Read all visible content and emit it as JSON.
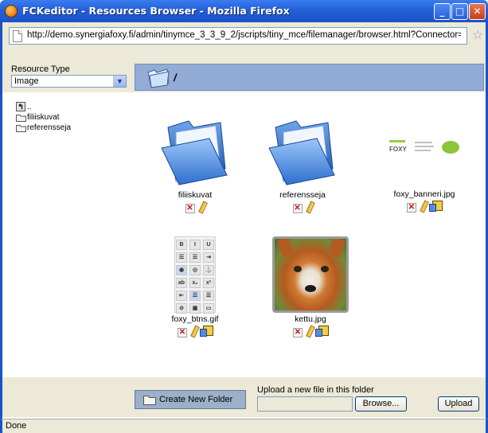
{
  "window": {
    "title": "FCKeditor - Resources Browser - Mozilla Firefox",
    "min_icon": "minimize-icon",
    "max_icon": "maximize-icon",
    "close_icon": "close-icon"
  },
  "urlbar": {
    "url": "http://demo.synergiafoxy.fi/admin/tinymce_3_3_9_2/jscripts/tiny_mce/filemanager/browser.html?Connector="
  },
  "resource_type": {
    "label": "Resource Type",
    "selected": "Image"
  },
  "path": {
    "current": "/"
  },
  "tree": {
    "items": [
      {
        "label": "..",
        "icon": "folder-up-icon"
      },
      {
        "label": "filiiskuvat",
        "icon": "folder-icon"
      },
      {
        "label": "referensseja",
        "icon": "folder-icon"
      }
    ]
  },
  "files": [
    {
      "name": "filiiskuvat",
      "kind": "folder"
    },
    {
      "name": "referensseja",
      "kind": "folder"
    },
    {
      "name": "foxy_banneri.jpg",
      "kind": "image",
      "thumb_text": "FOXY"
    },
    {
      "name": "foxy_btns.gif",
      "kind": "image"
    },
    {
      "name": "kettu.jpg",
      "kind": "image"
    }
  ],
  "actions": {
    "new_folder": "Create New Folder",
    "upload_label": "Upload a new file in this folder",
    "browse": "Browse...",
    "upload": "Upload"
  },
  "status": {
    "text": "Done"
  },
  "colors": {
    "titlebar": "#2460d8",
    "pathbar": "#93acd6",
    "chrome": "#ece9d8"
  }
}
